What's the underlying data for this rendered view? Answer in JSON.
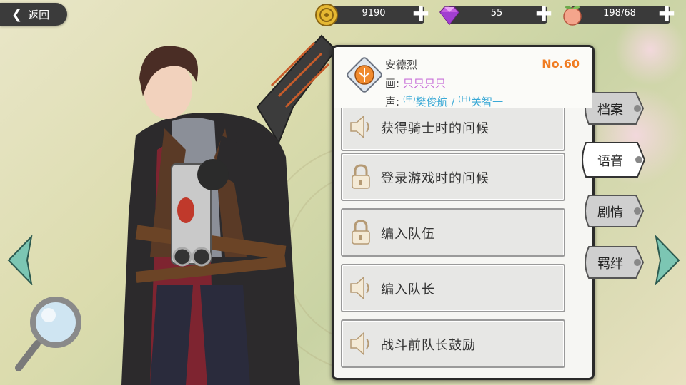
{
  "back": {
    "label": "返回"
  },
  "resources": [
    {
      "icon": "gold-coin-icon",
      "value": "9190"
    },
    {
      "icon": "diamond-icon",
      "value": "55"
    },
    {
      "icon": "peach-stamina-icon",
      "value": "198/68"
    }
  ],
  "profile": {
    "name": "安德烈",
    "number": "No.60",
    "artist_prefix": "画:",
    "artist": "只只只只",
    "voice_prefix": "声:",
    "voice_cn_tag": "(中)",
    "voice_cn": "樊俊航",
    "voice_sep": " / ",
    "voice_jp_tag": "(日)",
    "voice_jp": "关智一"
  },
  "voice_lines": [
    {
      "label": "获得骑士时的问候",
      "icon": "speaker-icon"
    },
    {
      "label": "登录游戏时的问候",
      "icon": "lock-icon"
    },
    {
      "label": "编入队伍",
      "icon": "lock-icon"
    },
    {
      "label": "编入队长",
      "icon": "speaker-icon"
    },
    {
      "label": "战斗前队长鼓励",
      "icon": "speaker-icon"
    }
  ],
  "tabs": [
    {
      "label": "档案",
      "selected": false
    },
    {
      "label": "语音",
      "selected": true
    },
    {
      "label": "剧情",
      "selected": false
    },
    {
      "label": "羁绊",
      "selected": false
    }
  ],
  "colors": {
    "accent_number": "#f07c22",
    "artist": "#c86fd8",
    "voice": "#3aa9d6"
  }
}
